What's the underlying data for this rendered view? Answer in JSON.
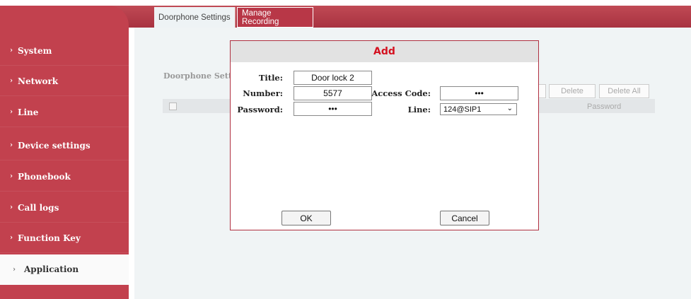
{
  "tabs": [
    {
      "label": "Doorphone Settings",
      "active": false
    },
    {
      "label": "Manage Recording",
      "active": true
    }
  ],
  "sidebar": {
    "items": [
      {
        "label": "System"
      },
      {
        "label": "Network"
      },
      {
        "label": "Line"
      },
      {
        "label": "Device settings"
      },
      {
        "label": "Phonebook"
      },
      {
        "label": "Call logs"
      },
      {
        "label": "Function Key"
      },
      {
        "label": "Application",
        "active": true
      }
    ]
  },
  "background": {
    "section_label": "Doorphone Setti",
    "delete_label": "Delete",
    "delete_all_label": "Delete All",
    "col_password": "Password"
  },
  "dialog": {
    "title": "Add",
    "title_label": "Title:",
    "title_value": "Door lock 2",
    "number_label": "Number:",
    "number_value": "5577",
    "access_label": "Access Code:",
    "access_value": "•••",
    "password_label": "Password:",
    "password_value": "•••",
    "line_label": "Line:",
    "line_value": "124@SIP1",
    "ok_label": "OK",
    "cancel_label": "Cancel"
  },
  "colors": {
    "accent": "#c2414e",
    "dialog_title": "#d4101f"
  }
}
